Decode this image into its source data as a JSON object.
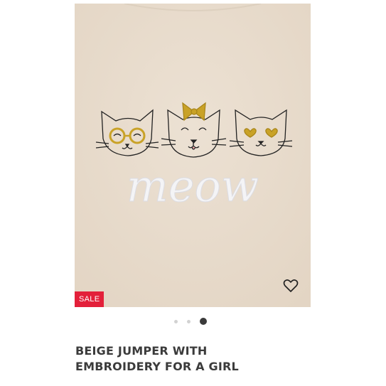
{
  "product": {
    "image_alt": "Beige jumper with cat embroidery",
    "embroidery_text": "meow",
    "badge": "SALE",
    "wishlist_icon": "heart-outline-icon",
    "title_line1": "BEIGE JUMPER WITH",
    "title_line2": "EMBROIDERY FOR A GIRL"
  },
  "carousel": {
    "total": 3,
    "active_index": 2
  },
  "colors": {
    "fabric": "#e9dccd",
    "sale": "#e3203a",
    "gold": "#c9a227",
    "title": "#3b3b3b"
  }
}
